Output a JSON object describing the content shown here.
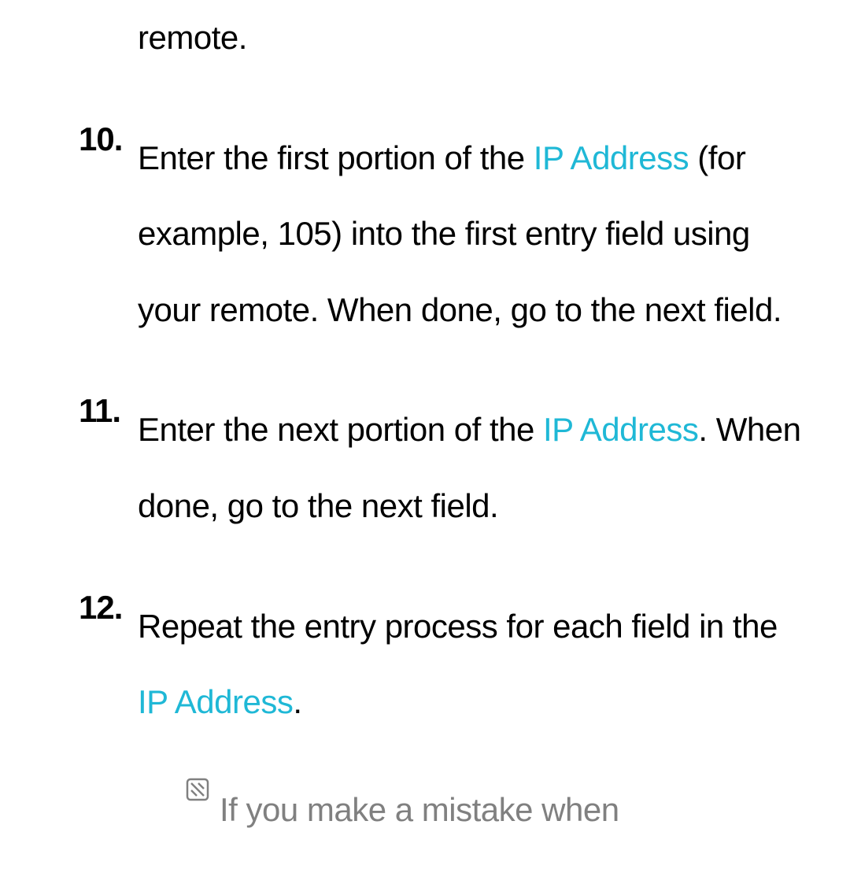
{
  "colors": {
    "term": "#1fb8d6",
    "note": "#808080"
  },
  "prev_remnant": "remote.",
  "steps": [
    {
      "num": "10.",
      "pre": "Enter the first portion of the ",
      "term": "IP Address",
      "post": " (for example, 105) into the first entry field using your remote. When done, go to the next field."
    },
    {
      "num": "11.",
      "pre": "Enter the next portion of the ",
      "term": "IP Address",
      "post": ". When done, go to the next field."
    },
    {
      "num": "12.",
      "pre": "Repeat the entry process for each field in the ",
      "term": "IP Address",
      "post": "."
    }
  ],
  "note": {
    "icon": "note-icon",
    "text": "If you make a mistake when"
  }
}
